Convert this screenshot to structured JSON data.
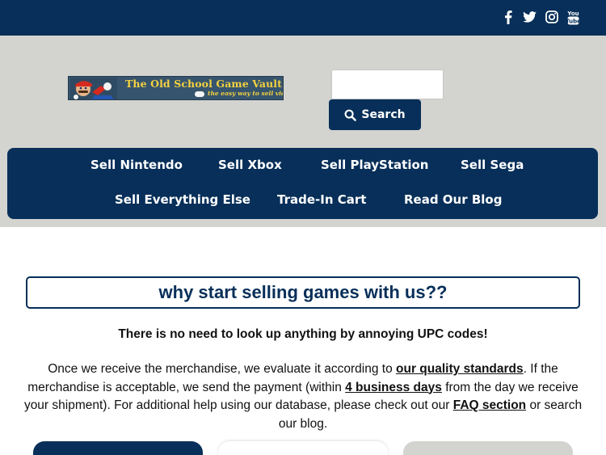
{
  "social": {
    "icons": [
      "facebook-icon",
      "twitter-icon",
      "instagram-icon",
      "youtube-icon"
    ]
  },
  "logo": {
    "title": "The Old School Game Vault",
    "tagline": "the easy way to sell video games"
  },
  "search": {
    "input_value": "",
    "button_label": "Search"
  },
  "nav": {
    "items": [
      "Sell Nintendo",
      "Sell Xbox",
      "Sell PlayStation",
      "Sell Sega",
      "Sell Everything Else",
      "Trade-In Cart",
      "Read Our Blog"
    ]
  },
  "main": {
    "headline": "why start selling games with us??",
    "no_upc": "There is no need to look up anything by annoying UPC codes!",
    "para": {
      "p1": "Once we receive the merchandise, we evaluate it according to ",
      "link1": "our quality standards",
      "p2": ". If the merchandise is acceptable, we send the payment (within ",
      "link2": "4 business days",
      "p3": " from the day we receive your shipment). For additional help using our database, please check out our ",
      "link3": "FAQ section",
      "p4": " or search our blog."
    }
  },
  "colors": {
    "navy": "#072f59",
    "header_gray": "#d3d3cf",
    "logo_gold": "#f6d23f"
  }
}
